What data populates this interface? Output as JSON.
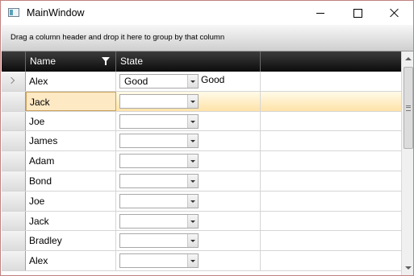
{
  "window": {
    "title": "MainWindow",
    "icon": "app-window-icon"
  },
  "titlebar": {
    "minimize_icon": "minimize-icon",
    "maximize_icon": "maximize-icon",
    "close_icon": "close-icon"
  },
  "grid": {
    "group_panel_text": "Drag a column header and drop it here to group by that column",
    "columns": {
      "name": "Name",
      "state": "State"
    },
    "rows": [
      {
        "name": "Alex",
        "state_value": "Good",
        "state_text": "Good",
        "current": true
      },
      {
        "name": "Jack",
        "state_value": "",
        "state_text": "",
        "selected": true
      },
      {
        "name": "Joe",
        "state_value": "",
        "state_text": ""
      },
      {
        "name": "James",
        "state_value": "",
        "state_text": ""
      },
      {
        "name": "Adam",
        "state_value": "",
        "state_text": ""
      },
      {
        "name": "Bond",
        "state_value": "",
        "state_text": ""
      },
      {
        "name": "Joe",
        "state_value": "",
        "state_text": ""
      },
      {
        "name": "Jack",
        "state_value": "",
        "state_text": ""
      },
      {
        "name": "Bradley",
        "state_value": "",
        "state_text": ""
      },
      {
        "name": "Alex",
        "state_value": "",
        "state_text": ""
      }
    ]
  },
  "colors": {
    "selection": "#ffe3a8",
    "header": "#1a1a1a",
    "window_border": "#c08080"
  }
}
